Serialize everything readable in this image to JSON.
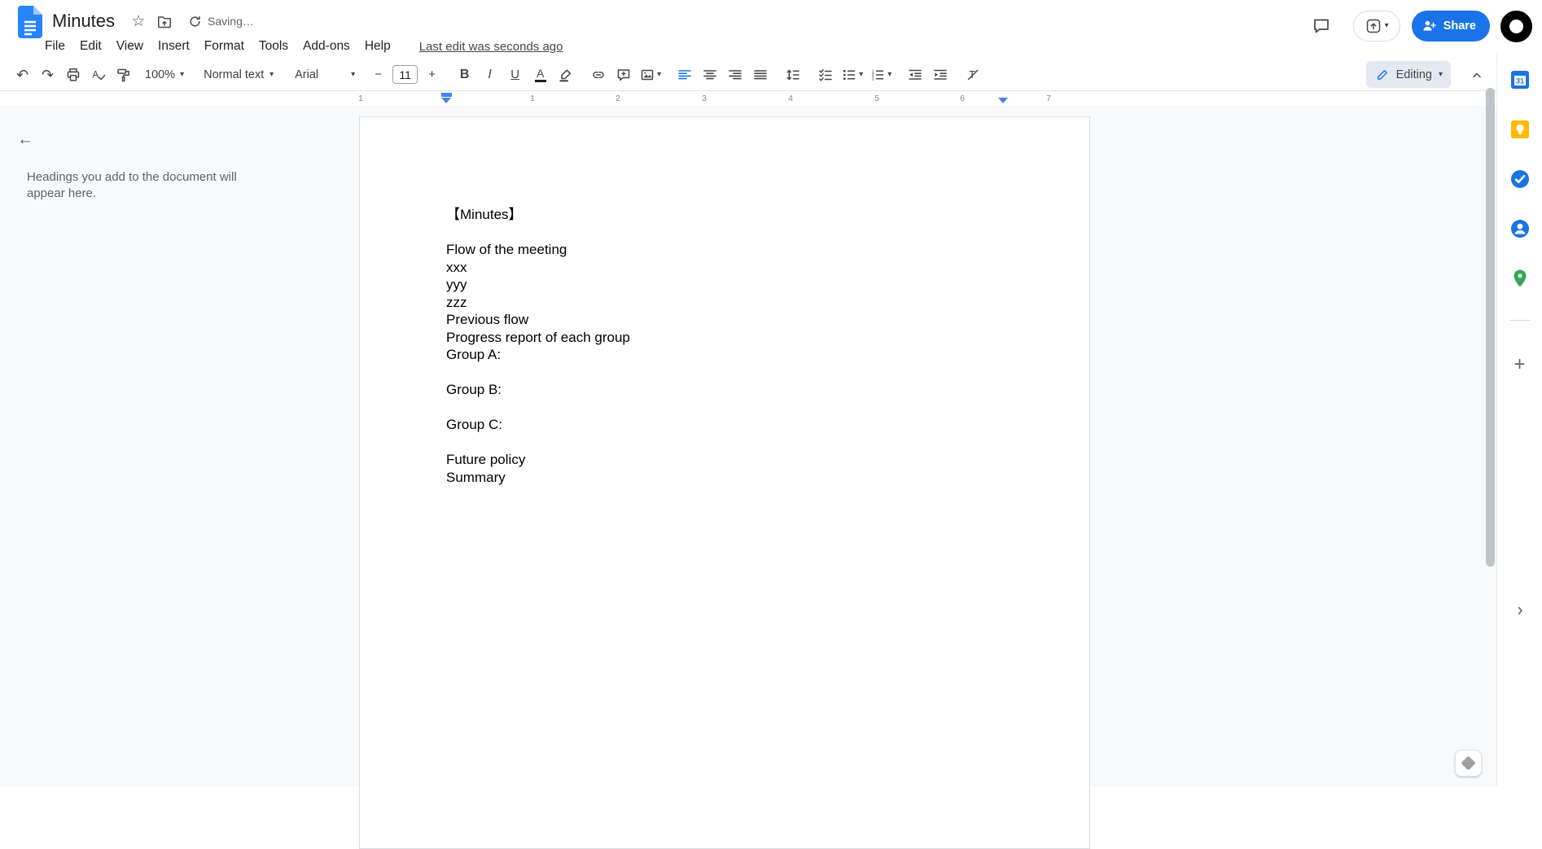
{
  "titlebar": {
    "doc_title": "Minutes",
    "saving_status": "Saving…",
    "share_label": "Share"
  },
  "menubar": {
    "items": [
      "File",
      "Edit",
      "View",
      "Insert",
      "Format",
      "Tools",
      "Add-ons",
      "Help"
    ],
    "last_edit_label": "Last edit was seconds ago"
  },
  "toolbar": {
    "zoom_value": "100%",
    "styles_value": "Normal text",
    "font_value": "Arial",
    "font_size_value": "11",
    "mode_label": "Editing"
  },
  "ruler": {
    "labels": [
      "1",
      "1",
      "2",
      "3",
      "4",
      "5",
      "6",
      "7"
    ]
  },
  "outline": {
    "placeholder": "Headings you add to the document will appear here."
  },
  "document": {
    "lines": [
      "【Minutes】",
      "",
      "Flow of the meeting",
      "xxx",
      "yyy",
      "zzz",
      "Previous flow",
      "Progress report of each group",
      "Group A:",
      "",
      "Group B:",
      "",
      "Group C:",
      "",
      "Future policy",
      "Summary"
    ]
  },
  "icons": {
    "undo": "↶",
    "redo": "↷",
    "star": "☆",
    "caret_down": "▾",
    "minus": "−",
    "plus": "+",
    "bold": "B",
    "italic": "I",
    "underline": "U",
    "text_color": "A",
    "back_arrow": "←",
    "rail_plus": "+",
    "panel_chevron": "›"
  },
  "colors": {
    "accent_blue": "#1a73e8",
    "ruler_marker_blue": "#4285f4",
    "editing_pill_bg": "#e3e9f2"
  }
}
